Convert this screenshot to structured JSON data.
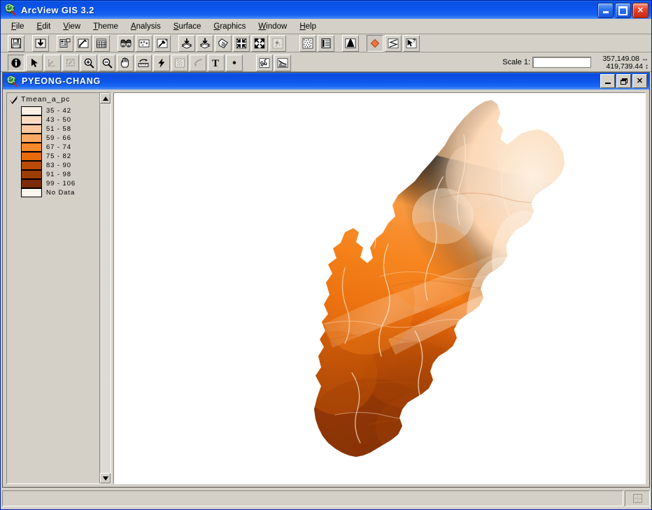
{
  "window": {
    "title": "ArcView GIS 3.2",
    "app_icon": "arcview-globe-icon",
    "buttons": {
      "minimize": "minimize",
      "maximize": "maximize",
      "close": "close"
    }
  },
  "menubar": {
    "items": [
      {
        "label": "File",
        "accel": "F"
      },
      {
        "label": "Edit",
        "accel": "E"
      },
      {
        "label": "View",
        "accel": "V"
      },
      {
        "label": "Theme",
        "accel": "T"
      },
      {
        "label": "Analysis",
        "accel": "A"
      },
      {
        "label": "Surface",
        "accel": "S"
      },
      {
        "label": "Graphics",
        "accel": "G"
      },
      {
        "label": "Window",
        "accel": "W"
      },
      {
        "label": "Help",
        "accel": "H"
      }
    ]
  },
  "toolbar_row1": {
    "buttons": [
      {
        "name": "save-project-button",
        "icon": "floppy-disk-icon",
        "state": "enabled"
      },
      {
        "name": "add-theme-button",
        "icon": "add-theme-icon",
        "state": "enabled"
      },
      {
        "name": "theme-properties-button",
        "icon": "theme-properties-icon",
        "state": "enabled"
      },
      {
        "name": "legend-editor-button",
        "icon": "legend-pencil-icon",
        "state": "enabled"
      },
      {
        "name": "open-table-button",
        "icon": "table-grid-icon",
        "state": "enabled"
      },
      {
        "name": "find-button",
        "icon": "binoculars-icon",
        "state": "enabled"
      },
      {
        "name": "query-builder-button",
        "icon": "query-diamonds-icon",
        "state": "enabled"
      },
      {
        "name": "select-features-button",
        "icon": "hammer-wand-icon",
        "state": "enabled"
      },
      {
        "name": "clip-theme-button",
        "icon": "layer-stack-down-icon",
        "state": "enabled"
      },
      {
        "name": "merge-theme-button",
        "icon": "layer-stack-down-2-icon",
        "state": "enabled"
      },
      {
        "name": "mask-theme-button",
        "icon": "polygon-dotted-icon",
        "state": "enabled"
      },
      {
        "name": "zoom-to-selected-button",
        "icon": "arrows-in-icon",
        "state": "enabled"
      },
      {
        "name": "zoom-to-full-extent-button",
        "icon": "arrows-out-icon",
        "state": "enabled"
      },
      {
        "name": "clear-selection-button",
        "icon": "sparkle-clear-icon",
        "state": "disabled"
      },
      {
        "name": "histogram-grid-button",
        "icon": "dotted-pattern-icon",
        "state": "enabled"
      },
      {
        "name": "layout-button",
        "icon": "layout-panel-icon",
        "state": "enabled"
      },
      {
        "name": "histogram-button",
        "icon": "histogram-peak-icon",
        "state": "enabled"
      },
      {
        "name": "draw-marker-button",
        "icon": "orange-diamond-icon",
        "state": "pressed"
      },
      {
        "name": "draw-line-button",
        "icon": "polyline-icon",
        "state": "enabled"
      },
      {
        "name": "context-help-button",
        "icon": "help-arrow-icon",
        "state": "enabled"
      }
    ]
  },
  "toolbar_row2": {
    "buttons": [
      {
        "name": "identify-tool",
        "icon": "info-circle-icon",
        "state": "pressed"
      },
      {
        "name": "pointer-tool",
        "icon": "arrow-pointer-icon",
        "state": "enabled"
      },
      {
        "name": "select-by-line-tool",
        "icon": "select-line-icon",
        "state": "disabled"
      },
      {
        "name": "select-by-box-tool",
        "icon": "select-box-icon",
        "state": "disabled"
      },
      {
        "name": "zoom-in-tool",
        "icon": "magnifier-plus-icon",
        "state": "enabled"
      },
      {
        "name": "zoom-out-tool",
        "icon": "magnifier-minus-icon",
        "state": "enabled"
      },
      {
        "name": "pan-tool",
        "icon": "hand-pan-icon",
        "state": "enabled"
      },
      {
        "name": "measure-tool",
        "icon": "measure-ruler-icon",
        "state": "enabled"
      },
      {
        "name": "hot-link-tool",
        "icon": "lightning-bolt-icon",
        "state": "enabled"
      },
      {
        "name": "area-select-tool",
        "icon": "dotted-square-icon",
        "state": "disabled"
      },
      {
        "name": "rotate-tool",
        "icon": "curved-arrow-icon",
        "state": "disabled"
      },
      {
        "name": "text-tool",
        "icon": "text-t-icon",
        "state": "enabled"
      },
      {
        "name": "draw-point-tool",
        "icon": "point-dot-icon",
        "state": "enabled"
      },
      {
        "name": "flow-direction-tool",
        "icon": "flow-swirl-icon",
        "state": "enabled"
      },
      {
        "name": "profile-tool",
        "icon": "profile-slope-icon",
        "state": "enabled"
      }
    ]
  },
  "scale": {
    "label": "Scale 1:",
    "value": "",
    "placeholder": ""
  },
  "coordinates": {
    "x": "357,149.08",
    "y": "419,739.44",
    "x_icon": "horizontal-arrows-icon",
    "y_icon": "vertical-arrows-icon"
  },
  "document_window": {
    "title": "PYEONG-CHANG",
    "icon": "arcview-view-icon",
    "buttons": {
      "minimize": "minimize",
      "restore": "restore",
      "close": "close"
    }
  },
  "table_of_contents": {
    "theme": {
      "name": "Tmean_a_pc",
      "visible": true,
      "checkbox_icon": "checkmark-icon"
    },
    "legend": [
      {
        "label": "35 - 42",
        "color": "#fdf0e6"
      },
      {
        "label": "43 - 50",
        "color": "#fbdcc2"
      },
      {
        "label": "51 - 58",
        "color": "#f9c89e"
      },
      {
        "label": "59 - 66",
        "color": "#f9a964"
      },
      {
        "label": "67 - 74",
        "color": "#f98a2a"
      },
      {
        "label": "75 - 82",
        "color": "#ea6a0a"
      },
      {
        "label": "83 - 90",
        "color": "#b94b05"
      },
      {
        "label": "91 - 98",
        "color": "#9c3c04"
      },
      {
        "label": "99 - 106",
        "color": "#7a2d05"
      },
      {
        "label": "No Data",
        "color": "#fdf6ec"
      }
    ]
  },
  "map": {
    "theme_field": "Tmean_a_pc",
    "region_name": "PYEONG-CHANG",
    "background_color": "#ffffff",
    "low_value_area": "northeast",
    "high_value_area": "south"
  },
  "statusbar": {
    "message": "",
    "grid_icon": "four-pane-grid-icon"
  }
}
